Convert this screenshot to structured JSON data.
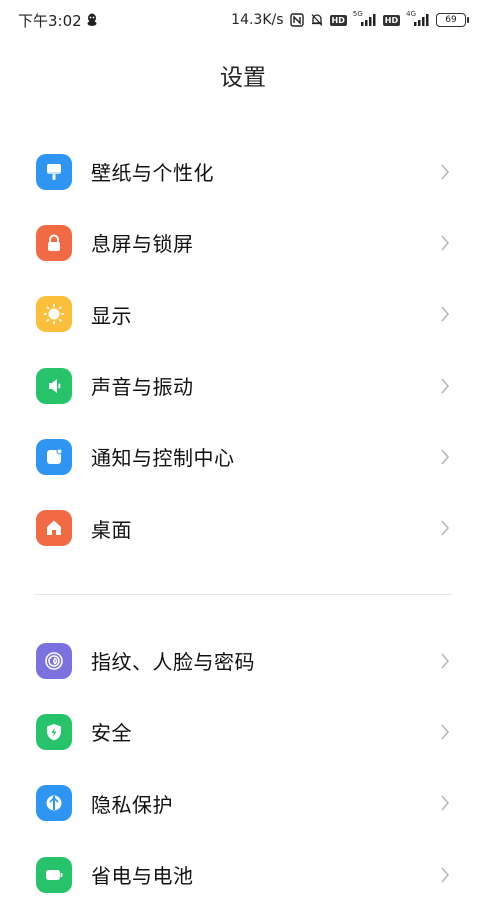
{
  "status_bar": {
    "time": "下午3:02",
    "net_speed": "14.3K/s",
    "hd1": "HD",
    "net1": "5G",
    "hd2": "HD",
    "net2": "4G",
    "battery": "69"
  },
  "header": {
    "title": "设置"
  },
  "groups": [
    {
      "items": [
        {
          "label": "壁纸与个性化",
          "icon": "wallpaper-icon",
          "color": "#2f95f3"
        },
        {
          "label": "息屏与锁屏",
          "icon": "lock-icon",
          "color": "#f26a43"
        },
        {
          "label": "显示",
          "icon": "sun-icon",
          "color": "#fbbf3c"
        },
        {
          "label": "声音与振动",
          "icon": "speaker-icon",
          "color": "#27c36b"
        },
        {
          "label": "通知与控制中心",
          "icon": "notification-icon",
          "color": "#2f95f3"
        },
        {
          "label": "桌面",
          "icon": "home-icon",
          "color": "#f26a43"
        }
      ]
    },
    {
      "items": [
        {
          "label": "指纹、人脸与密码",
          "icon": "fingerprint-icon",
          "color": "#7b72e0"
        },
        {
          "label": "安全",
          "icon": "shield-icon",
          "color": "#27c36b"
        },
        {
          "label": "隐私保护",
          "icon": "privacy-icon",
          "color": "#2f95f3"
        },
        {
          "label": "省电与电池",
          "icon": "battery-icon",
          "color": "#27c36b"
        }
      ]
    }
  ]
}
